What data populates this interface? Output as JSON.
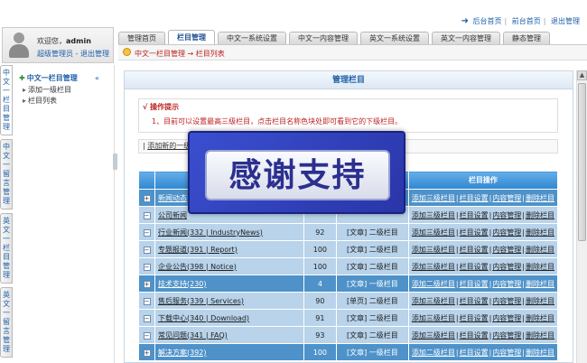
{
  "header": {
    "links": [
      "后台首页",
      "前台首页",
      "退出管理"
    ],
    "tabs": [
      {
        "label": "管理首页",
        "active": false
      },
      {
        "label": "栏目管理",
        "active": true
      },
      {
        "label": "中文一系统设置",
        "active": false
      },
      {
        "label": "中文一内容管理",
        "active": false
      },
      {
        "label": "英文一系统设置",
        "active": false
      },
      {
        "label": "英文一内容管理",
        "active": false
      },
      {
        "label": "静态管理",
        "active": false
      }
    ]
  },
  "user": {
    "welcome_prefix": "欢迎您，",
    "name": "admin",
    "role": "超级管理员",
    "logout": "退出管理"
  },
  "breadcrumb": "中文一栏目管理 → 栏目列表",
  "vtabs": [
    "中文一栏目管理",
    "中文一留言管理",
    "英文一栏目管理",
    "英文一留言管理"
  ],
  "sidebar": {
    "title": "中文一栏目管理",
    "collapse_symbol": "«",
    "items": [
      "添加一级栏目",
      "栏目列表"
    ]
  },
  "panel": {
    "title": "管理栏目",
    "tips_title": "操作提示",
    "tips_text": "1、目前可以设置最高三级栏目，点击栏目名称色块处即可看到它的下级栏目。",
    "add_link": "添加新的一级"
  },
  "table": {
    "headers": [
      "",
      "",
      "",
      "",
      "栏目操作"
    ],
    "rows": [
      {
        "level": 1,
        "name": "新闻动态",
        "order": "",
        "type": "",
        "ops": [
          "添加三级栏目",
          "栏目设置",
          "内容管理",
          "删除栏目"
        ]
      },
      {
        "level": 2,
        "name": "公司新闻",
        "order": "",
        "type": "",
        "ops": [
          "添加三级栏目",
          "栏目设置",
          "内容管理",
          "删除栏目"
        ]
      },
      {
        "level": 2,
        "name": "行业新闻(332 | IndustryNews)",
        "order": "92",
        "type": "[文章] 二级栏目",
        "ops": [
          "添加三级栏目",
          "栏目设置",
          "内容管理",
          "删除栏目"
        ]
      },
      {
        "level": 2,
        "name": "专题报道(391 | Report)",
        "order": "100",
        "type": "[文章] 二级栏目",
        "ops": [
          "添加三级栏目",
          "栏目设置",
          "内容管理",
          "删除栏目"
        ]
      },
      {
        "level": 2,
        "name": "企业公告(398 | Notice)",
        "order": "100",
        "type": "[文章] 二级栏目",
        "ops": [
          "添加三级栏目",
          "栏目设置",
          "内容管理",
          "删除栏目"
        ]
      },
      {
        "level": 1,
        "name": "技术支持(230)",
        "order": "4",
        "type": "[文章] 一级栏目",
        "ops": [
          "添加二级栏目",
          "栏目设置",
          "内容管理",
          "删除栏目"
        ]
      },
      {
        "level": 2,
        "name": "售后服务(339 | Services)",
        "order": "90",
        "type": "[单页] 二级栏目",
        "ops": [
          "添加三级栏目",
          "栏目设置",
          "内容管理",
          "删除栏目"
        ]
      },
      {
        "level": 2,
        "name": "下载中心(340 | Download)",
        "order": "91",
        "type": "[文章] 二级栏目",
        "ops": [
          "添加三级栏目",
          "栏目设置",
          "内容管理",
          "删除栏目"
        ]
      },
      {
        "level": 2,
        "name": "常见问题(341 | FAQ)",
        "order": "93",
        "type": "[文章] 二级栏目",
        "ops": [
          "添加三级栏目",
          "栏目设置",
          "内容管理",
          "删除栏目"
        ]
      },
      {
        "level": 1,
        "name": "解决方案(392)",
        "order": "100",
        "type": "[文章] 一级栏目",
        "ops": [
          "添加二级栏目",
          "栏目设置",
          "内容管理",
          "删除栏目"
        ]
      }
    ]
  },
  "overlay": {
    "text": "感谢支持"
  },
  "colors": {
    "header_blue": "#1f5fa8",
    "row_level1": "#4e92c9",
    "row_level2": "#b8d3ea",
    "tip_red": "#bb2222",
    "badge_blue": "#2a35a8"
  },
  "icons": {
    "expand": "plus-box-icon",
    "collapse": "minus-box-icon",
    "home": "home-arrow-icon",
    "tip": "lightbulb-icon",
    "avatar": "user-avatar-icon"
  }
}
